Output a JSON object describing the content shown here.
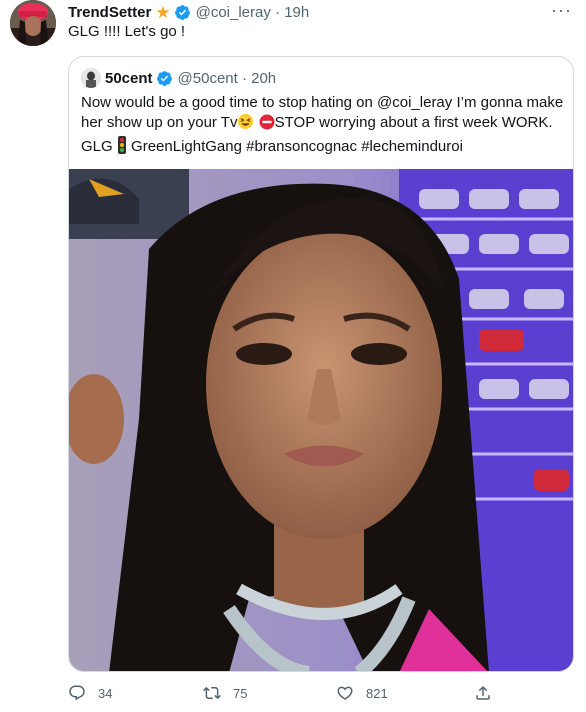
{
  "tweet": {
    "display_name": "TrendSetter",
    "handle_time": "@coi_leray · 19h",
    "text": "GLG !!!! Let's go !",
    "more": "···"
  },
  "quote": {
    "display_name": "50cent",
    "handle_time": "@50cent · 20h",
    "text_1": "Now would be a good time to stop hating on @coi_leray I’m gonna make her show up on your Tv",
    "text_2": "STOP worrying about a first week WORK. GLG",
    "text_3": "GreenLightGang #bransoncognac #lecheminduroi"
  },
  "actions": {
    "replies": "34",
    "retweets": "75",
    "likes": "821"
  },
  "icons": [
    "star-icon",
    "verified-icon",
    "more-icon",
    "reply-icon",
    "retweet-icon",
    "like-icon",
    "share-icon",
    "laughing-emoji-icon",
    "stop-sign-icon",
    "traffic-light-icon"
  ],
  "colors": {
    "verified": "#1d9bf0",
    "secondary_text": "#536471",
    "border": "#cfd9de",
    "star": "#f5a623"
  }
}
